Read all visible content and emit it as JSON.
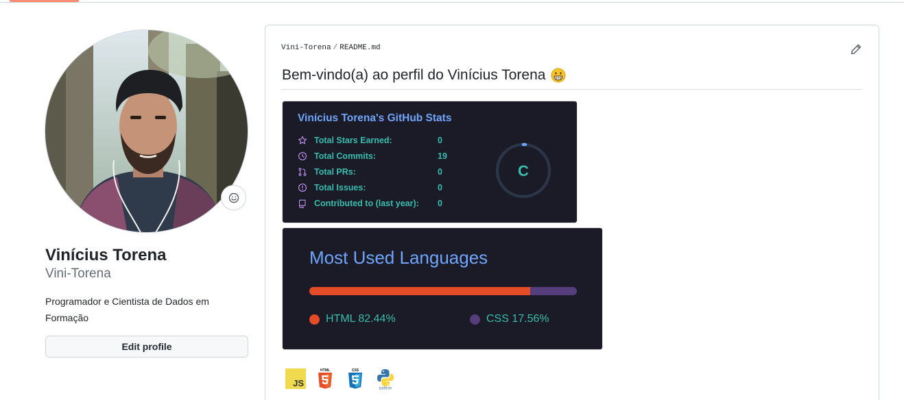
{
  "profile": {
    "full_name": "Vinícius Torena",
    "username": "Vini-Torena",
    "bio": "Programador e Cientista de Dados em Formação",
    "edit_label": "Edit profile"
  },
  "readme": {
    "owner": "Vini-Torena",
    "separator": "/",
    "file": "README.md",
    "heading": "Bem-vindo(a) ao perfil do Vinícius Torena",
    "heading_emoji": "grinning-face"
  },
  "stats": {
    "title": "Vinícius Torena's GitHub Stats",
    "rank": "C",
    "rows": [
      {
        "label": "Total Stars Earned:",
        "value": "0",
        "icon": "star-icon"
      },
      {
        "label": "Total Commits:",
        "value": "19",
        "icon": "history-icon"
      },
      {
        "label": "Total PRs:",
        "value": "0",
        "icon": "pull-request-icon"
      },
      {
        "label": "Total Issues:",
        "value": "0",
        "icon": "issue-icon"
      },
      {
        "label": "Contributed to (last year):",
        "value": "0",
        "icon": "repo-icon"
      }
    ],
    "colors": {
      "title": "#70a5fd",
      "text": "#38bdae",
      "icon": "#bf91f3",
      "bg": "#1a1b27"
    }
  },
  "languages": {
    "title": "Most Used Languages",
    "items": [
      {
        "name": "HTML",
        "percent": 82.44,
        "label": "HTML 82.44%",
        "color": "#e34c26"
      },
      {
        "name": "CSS",
        "percent": 17.56,
        "label": "CSS 17.56%",
        "color": "#563d7c"
      }
    ]
  },
  "tech_icons": [
    {
      "name": "javascript-icon",
      "text": "JS"
    },
    {
      "name": "html5-icon",
      "text": "HTML"
    },
    {
      "name": "css3-icon",
      "text": "CSS"
    },
    {
      "name": "python-icon",
      "text": "python"
    }
  ]
}
